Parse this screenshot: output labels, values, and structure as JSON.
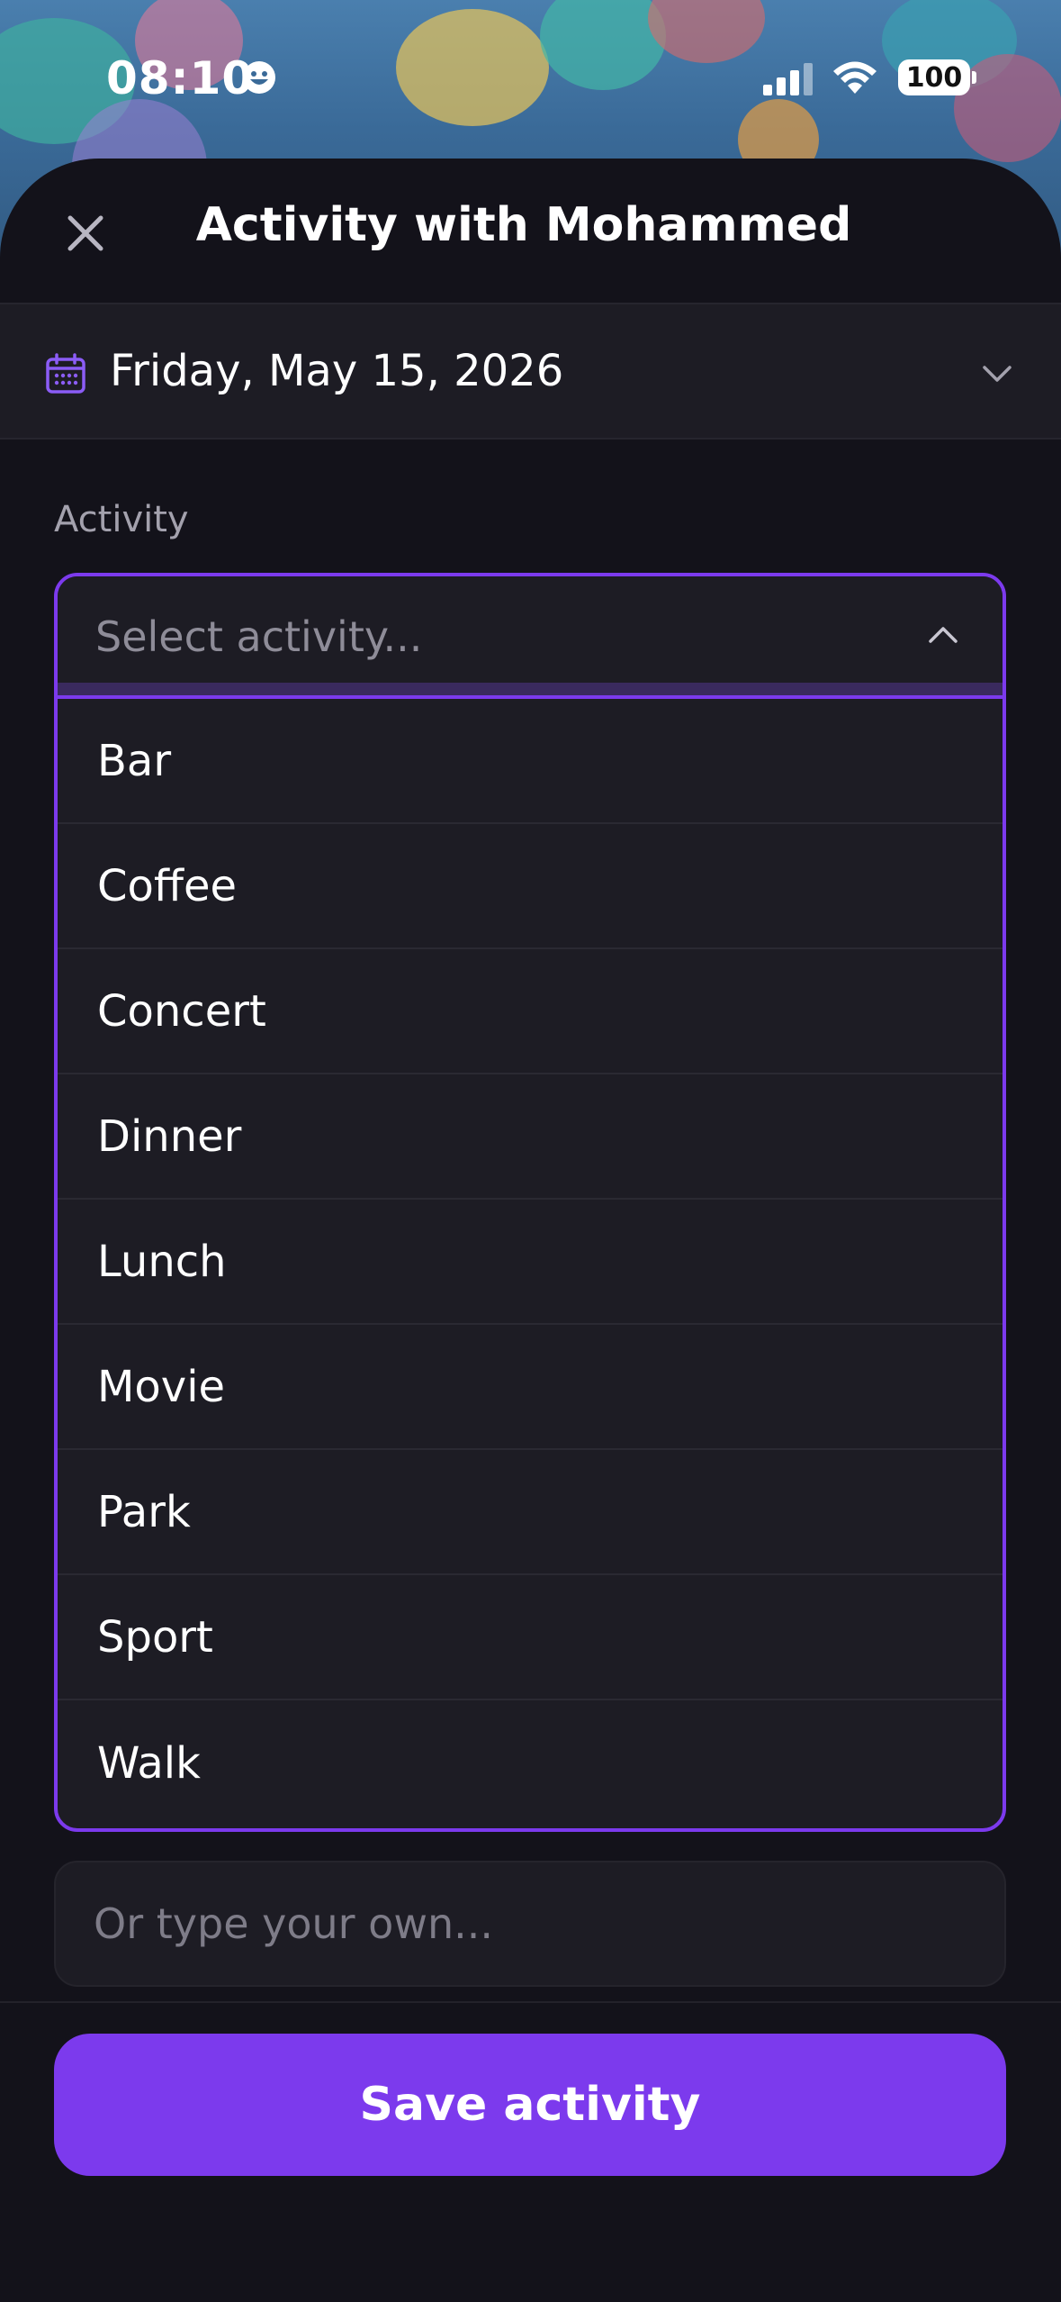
{
  "status_bar": {
    "time": "08:10",
    "battery": "100",
    "icons": [
      "emoji-smile-icon",
      "cellular-signal-icon",
      "wifi-icon",
      "battery-icon"
    ]
  },
  "sheet": {
    "title": "Activity with Mohammed",
    "close_icon": "close-icon"
  },
  "date_picker": {
    "value": "Friday, May 15, 2026",
    "icon": "calendar-icon",
    "chevron": "chevron-down-icon"
  },
  "activity": {
    "label": "Activity",
    "select_placeholder": "Select activity...",
    "options": [
      "Bar",
      "Coffee",
      "Concert",
      "Dinner",
      "Lunch",
      "Movie",
      "Park",
      "Sport",
      "Walk"
    ],
    "custom_placeholder": "Or type your own..."
  },
  "actions": {
    "save_label": "Save activity"
  },
  "colors": {
    "accent": "#7c3aed",
    "background": "#13121a",
    "surface": "#1d1c24"
  }
}
